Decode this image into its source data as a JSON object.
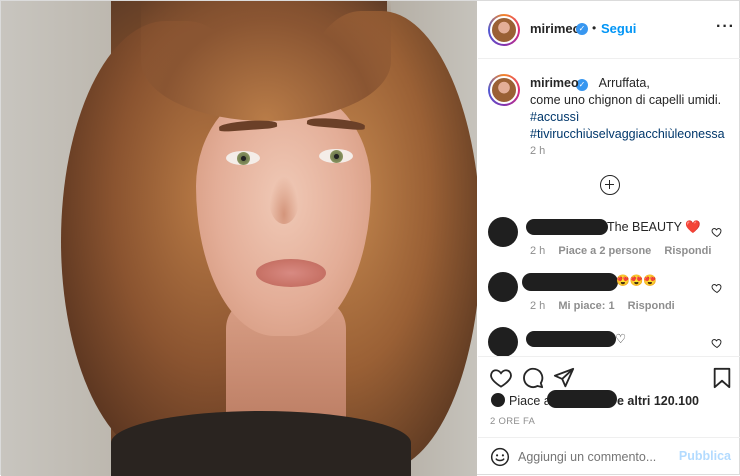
{
  "header": {
    "username": "mirimeo",
    "separator": "•",
    "follow_label": "Segui",
    "more_label": "···"
  },
  "caption": {
    "username": "mirimeo",
    "line1": "Arruffata,",
    "line2": "come uno chignon di capelli umidi.",
    "hashtag1": "#accussì",
    "hashtag2": "#tivirucchiùselvaggiacchiùleonessa",
    "time": "2 h"
  },
  "comments": [
    {
      "text": "The BEAUTY ❤️",
      "time": "2 h",
      "likes": "Piace a 2 persone",
      "reply": "Rispondi"
    },
    {
      "text": "😍😍😍",
      "time": "2 h",
      "likes": "Mi piace: 1",
      "reply": "Rispondi"
    },
    {
      "text": "♡",
      "time": "",
      "likes": "",
      "reply": ""
    }
  ],
  "likes": {
    "prefix": "Piace a",
    "suffix": "e altri 120.100"
  },
  "time_label": "2 ORE FA",
  "comment_box": {
    "placeholder": "Aggiungi un commento...",
    "post_label": "Pubblica"
  },
  "icons": {
    "verified": "verified-badge-icon",
    "heart": "heart-icon",
    "comment": "comment-icon",
    "share": "share-icon",
    "save": "bookmark-icon",
    "emoji": "emoji-icon",
    "load_more": "plus-circle-icon"
  },
  "colors": {
    "link": "#0095f6",
    "hashtag": "#00376b",
    "muted": "#8e8e8e",
    "post_disabled": "#b3dbff"
  }
}
